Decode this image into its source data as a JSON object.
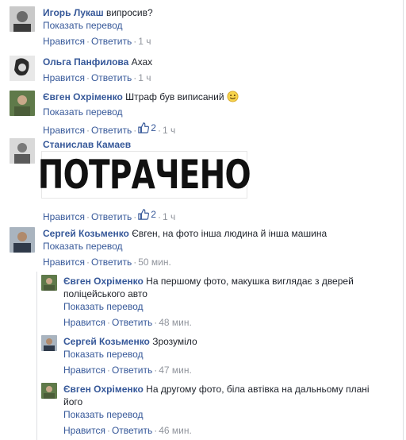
{
  "labels": {
    "show_translation": "Показать перевод",
    "like": "Нравится",
    "reply": "Ответить",
    "sep": "·"
  },
  "comments": [
    {
      "name": "Игорь Лукаш",
      "text": "випросив?",
      "likes": "",
      "time": "1 ч"
    },
    {
      "name": "Ольга Панфилова",
      "text": "Ахах",
      "likes": "",
      "time": "1 ч"
    },
    {
      "name": "Євген Охріменко",
      "text": "Штраф був виписаний",
      "likes": "2",
      "time": "1 ч",
      "emoji": "smile"
    },
    {
      "name": "Станислав Камаев",
      "sticker_text": "ПОТРАЧЕНО",
      "likes": "2",
      "time": "1 ч"
    },
    {
      "name": "Сергей Козьменко",
      "text": "Євген, на фото інша людина й інша машина",
      "likes": "",
      "time": "50 мин."
    }
  ],
  "replies": [
    {
      "name": "Євген Охріменко",
      "text_l1": "На першому фото, макушка виглядає з дверей",
      "text_l2": "поліцейського авто",
      "time": "48 мин."
    },
    {
      "name": "Сергей Козьменко",
      "text_l1": "Зрозуміло",
      "time": "47 мин."
    },
    {
      "name": "Євген Охріменко",
      "text_l1": "На другому фото, біла автівка на дальньому плані",
      "text_l2": "його",
      "time": "46 мин."
    }
  ],
  "colors": {
    "link": "#365899",
    "meta": "#90949c",
    "text": "#1d2129"
  }
}
